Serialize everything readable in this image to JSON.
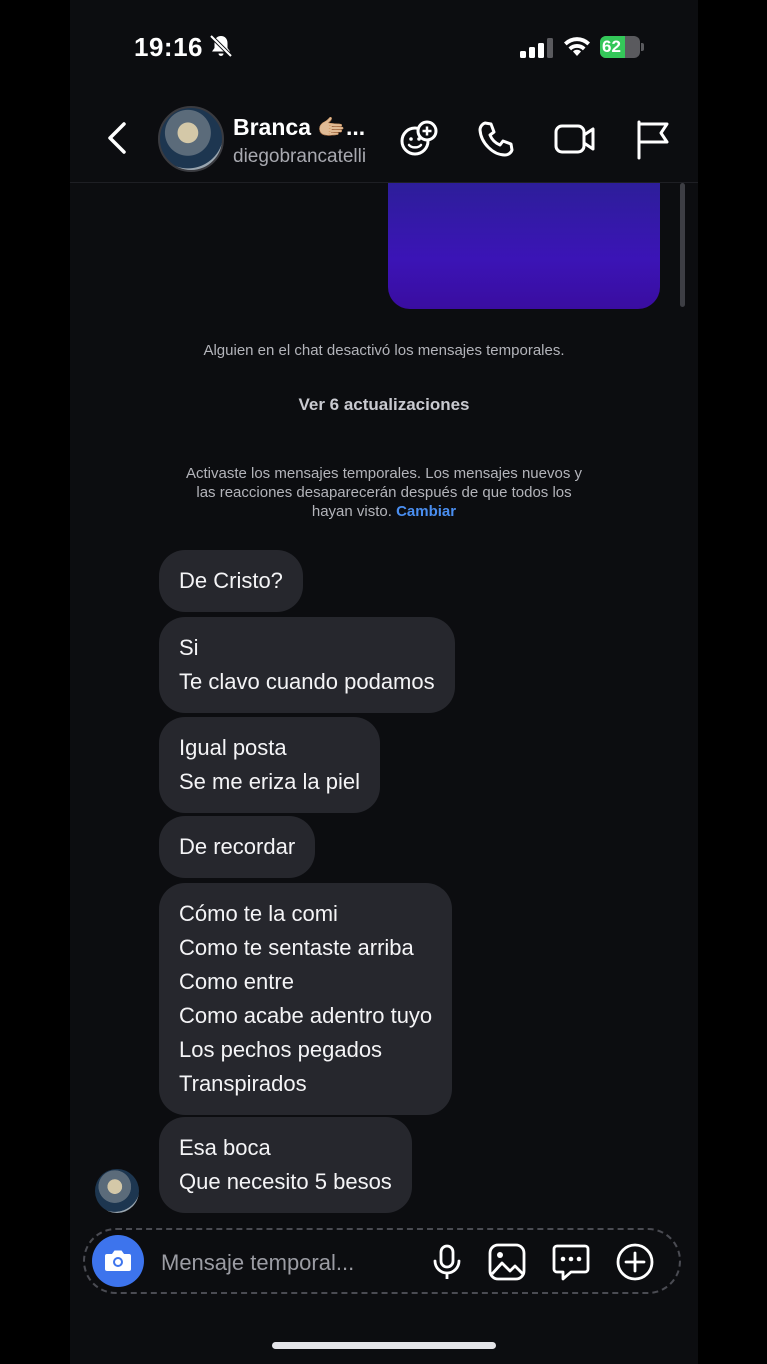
{
  "status_bar": {
    "time": "19:16",
    "battery": "62",
    "battery_level": 0.62
  },
  "header": {
    "name": "Branca 🫱🏼...",
    "handle": "diegobrancatelli"
  },
  "chat": {
    "system_1": "Alguien en el chat desactivó los mensajes temporales.",
    "updates": "Ver 6 actualizaciones",
    "system_2_lines": [
      "Activaste los mensajes temporales. Los mensajes nuevos y",
      "las reacciones desaparecerán después de que todos los",
      "hayan visto."
    ],
    "system_2_link": "Cambiar",
    "messages": [
      {
        "lines": [
          "De Cristo?"
        ]
      },
      {
        "lines": [
          "Si",
          "Te clavo cuando podamos"
        ]
      },
      {
        "lines": [
          "Igual posta",
          "Se me eriza la piel"
        ]
      },
      {
        "lines": [
          "De recordar"
        ]
      },
      {
        "lines": [
          "Cómo te la comi",
          "Como te sentaste arriba",
          "Como entre",
          "Como acabe adentro tuyo",
          "Los pechos pegados",
          "Transpirados"
        ]
      },
      {
        "lines": [
          "Esa boca",
          "Que necesito 5 besos"
        ]
      }
    ]
  },
  "composer": {
    "placeholder": "Mensaje temporal..."
  },
  "icons": {
    "header": [
      "back-icon",
      "add-people-icon",
      "phone-icon",
      "video-icon",
      "flag-icon"
    ],
    "composer": [
      "camera-icon",
      "microphone-icon",
      "gallery-icon",
      "sticker-icon",
      "plus-icon"
    ]
  },
  "colors": {
    "accent": "#3d74ed",
    "link": "#4a8ef0",
    "bubble": "#26272d",
    "media": "#3b14b6"
  }
}
